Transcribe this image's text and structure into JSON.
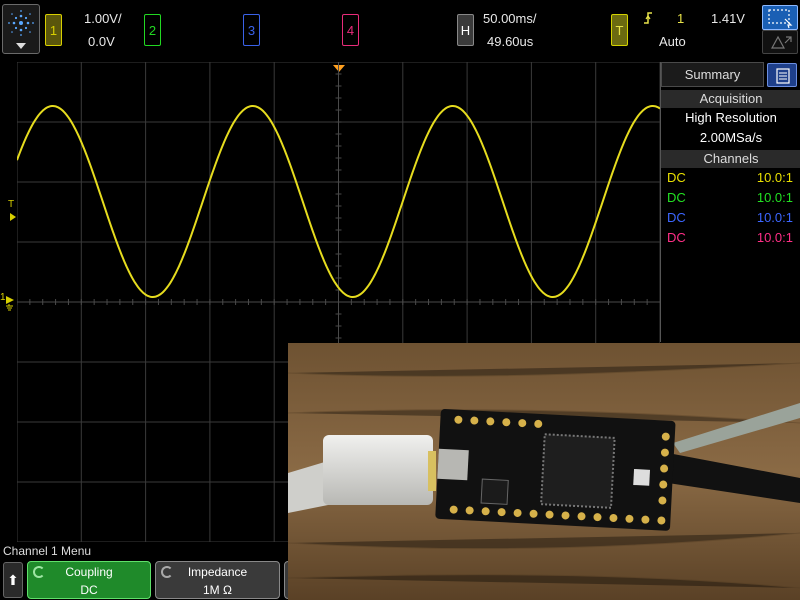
{
  "channels": [
    {
      "num": "1",
      "color": "#d8d000",
      "scale": "1.00V/",
      "offset": "0.0V"
    },
    {
      "num": "2",
      "color": "#22d822"
    },
    {
      "num": "3",
      "color": "#3a62e8"
    },
    {
      "num": "4",
      "color": "#e82c7a"
    }
  ],
  "horizontal": {
    "label": "H",
    "time_div": "50.00ms/",
    "delay": "49.60us"
  },
  "trigger": {
    "label": "T",
    "source": "1",
    "level": "1.41V",
    "mode": "Auto",
    "edge_icon": "rising-edge-icon"
  },
  "zoom_label": "⇱⇲",
  "summary": {
    "tab": "Summary",
    "acquisition_header": "Acquisition",
    "acq_mode": "High Resolution",
    "sample_rate": "2.00MSa/s",
    "channels_header": "Channels",
    "rows": [
      {
        "coupling": "DC",
        "probe": "10.0:1",
        "color": "#e8e000"
      },
      {
        "coupling": "DC",
        "probe": "10.0:1",
        "color": "#22e022"
      },
      {
        "coupling": "DC",
        "probe": "10.0:1",
        "color": "#3c66ff"
      },
      {
        "coupling": "DC",
        "probe": "10.0:1",
        "color": "#ff2e86"
      }
    ]
  },
  "markers": {
    "trigger_T": "T",
    "ground_1": "1"
  },
  "bottom": {
    "menu_title": "Channel 1 Menu",
    "up_arrow": "⬆",
    "softkeys": [
      {
        "label": "Coupling",
        "value": "DC"
      },
      {
        "label": "Impedance",
        "value": "1M Ω"
      }
    ]
  },
  "waveform": {
    "color": "#e6dc1e",
    "trace": "sine"
  }
}
